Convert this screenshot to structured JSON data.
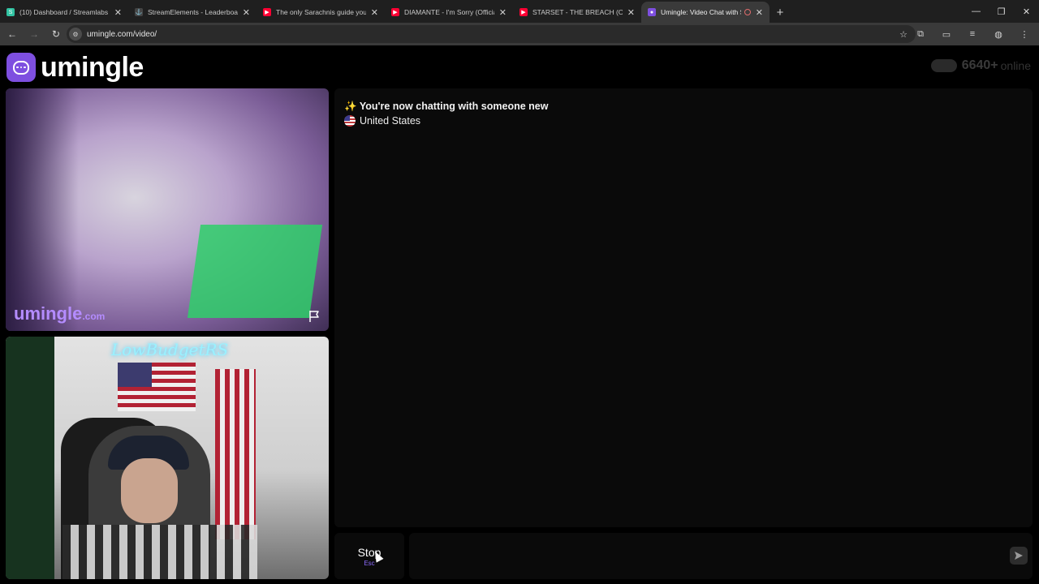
{
  "browser": {
    "tabs": [
      {
        "title": "(10) Dashboard / Streamlabs",
        "icon": "streamlabs-icon",
        "color": "#31c3a2"
      },
      {
        "title": "StreamElements - Leaderboard",
        "icon": "streamelements-icon",
        "color": "#444444"
      },
      {
        "title": "The only Sarachnis guide you n",
        "icon": "youtube-icon",
        "color": "#ff0033"
      },
      {
        "title": "DIAMANTE - I'm Sorry (Official",
        "icon": "youtube-icon",
        "color": "#ff0033"
      },
      {
        "title": "STARSET - THE BREACH (Officia",
        "icon": "youtube-icon",
        "color": "#ff0033"
      },
      {
        "title": "Umingle: Video Chat with St",
        "icon": "umingle-icon",
        "color": "#7e4fe0",
        "active": true
      }
    ],
    "url": "umingle.com/video/"
  },
  "site": {
    "logo_text": "umingle",
    "online_count": "6640+",
    "online_label": "online",
    "brand_color": "#7e4fe0"
  },
  "stranger_video": {
    "watermark": "umingle",
    "watermark_suffix": ".com"
  },
  "self_video": {
    "neon_sign": "LowBudgetRS"
  },
  "chat": {
    "status_emoji": "✨",
    "status_text": "You're now chatting with someone new",
    "country": "United States"
  },
  "controls": {
    "stop_label": "Stop",
    "stop_key": "Esc",
    "message_placeholder": ""
  }
}
